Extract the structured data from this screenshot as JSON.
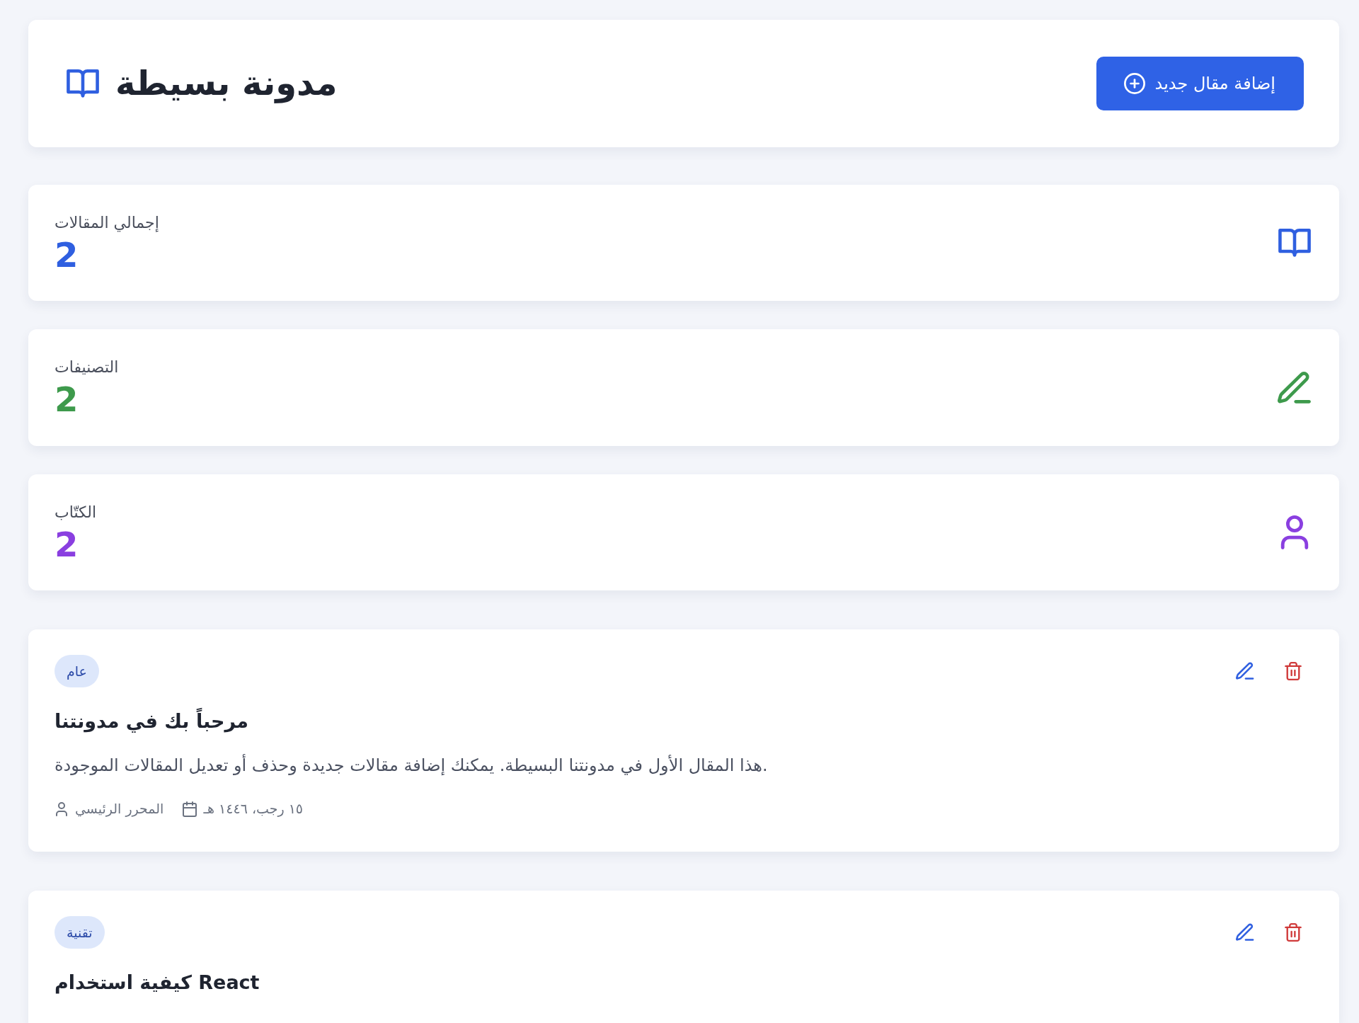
{
  "header": {
    "title": "مدونة بسيطة",
    "add_button": {
      "label": "إضافة مقال جديد"
    }
  },
  "stats": [
    {
      "kind": "posts",
      "label": "إجمالي المقالات",
      "value": "2",
      "color": "#2f5fe0"
    },
    {
      "kind": "categories",
      "label": "التصنيفات",
      "value": "2",
      "color": "#3e9a4c"
    },
    {
      "kind": "authors",
      "label": "الكتّاب",
      "value": "2",
      "color": "#8a3fe0"
    }
  ],
  "posts": [
    {
      "category": "عام",
      "title": "مرحباً بك في مدونتنا",
      "excerpt": "هذا المقال الأول في مدونتنا البسيطة. يمكنك إضافة مقالات جديدة وحذف أو تعديل المقالات الموجودة.",
      "author": "المحرر الرئيسي",
      "date": "١٥ رجب، ١٤٤٦ هـ"
    },
    {
      "category": "تقنية",
      "title": "كيفية استخدام React"
    }
  ]
}
